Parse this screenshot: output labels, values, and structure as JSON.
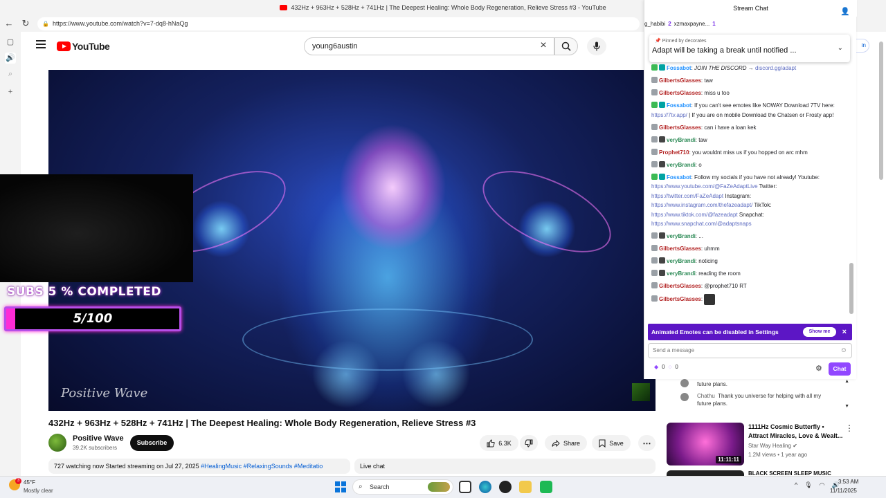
{
  "browser": {
    "window_title": "432Hz + 963Hz + 528Hz + 741Hz | The Deepest Healing: Whole Body Regeneration, Relieve Stress #3 - YouTube",
    "url": "https://www.youtube.com/watch?v=7-dq8-hNaQg",
    "sign_in_peek": "in"
  },
  "youtube": {
    "logo": "YouTube",
    "search_value": "young6austin",
    "video_title": "432Hz + 963Hz + 528Hz + 741Hz | The Deepest Healing: Whole Body Regeneration, Relieve Stress #3",
    "watermark": "Positive Wave",
    "channel_name": "Positive Wave",
    "channel_subs": "39.2K subscribers",
    "subscribe_label": "Subscribe",
    "like_count": "6.3K",
    "share_label": "Share",
    "save_label": "Save",
    "desc_stats": "727 watching now  Started streaming on Jul 27, 2025 ",
    "desc_tags": "#HealingMusic #RelaxingSounds #Meditatio",
    "live_chat_label": "Live chat",
    "peek": [
      {
        "text": "future plans."
      },
      {
        "user": "Chathu",
        "text": "Thank you universe for helping with all my future plans."
      }
    ],
    "recommended": [
      {
        "title": "1111Hz Cosmic Butterfly • Attract Miracles, Love & Wealt...",
        "channel": "Star Way Healing",
        "meta": "1.2M views • 1 year ago",
        "duration": "11:11:11"
      },
      {
        "title": "BLACK SCREEN SLEEP MUSIC"
      }
    ]
  },
  "overlay": {
    "sub_goal_text": "SUBS 5 % COMPLETED",
    "sub_goal_count": "5/100",
    "sub_goal_fraction": 0.05
  },
  "chat": {
    "header": "Stream Chat",
    "topline": [
      {
        "text": "g_habibi"
      },
      {
        "text": "2",
        "bold": true
      },
      {
        "text": "xzmaxpayne..."
      },
      {
        "text": "1",
        "bold": true
      }
    ],
    "pinned_by": "Pinned by decorates",
    "pinned_msg": "Adapt will be taking a break until notified ...",
    "messages": [
      {
        "user": "Fossabot",
        "color": "#1e90ff",
        "text": "JOIN THE DISCORD → ",
        "link": "discord.gg/adapt",
        "italic": true
      },
      {
        "user": "GilbertsGlasses",
        "color": "#b22222",
        "text": "taw"
      },
      {
        "user": "GilbertsGlasses",
        "color": "#b22222",
        "text": "miss u too"
      },
      {
        "user": "Fossabot",
        "color": "#1e90ff",
        "text": "If you can't see emotes like NOWAY Download 7TV here: ",
        "link": "https://7tv.app/",
        "tail": " | If you are on mobile Download the Chatsen or Frosty app!"
      },
      {
        "user": "GilbertsGlasses",
        "color": "#b22222",
        "text": "can i have a loan kek"
      },
      {
        "user": "veryBrandi",
        "color": "#2e8b57",
        "text": "taw"
      },
      {
        "user": "Prophet710",
        "color": "#b22222",
        "text": "you wouldnt miss us if you hopped on arc mhm"
      },
      {
        "user": "veryBrandi",
        "color": "#2e8b57",
        "text": "o"
      },
      {
        "user": "Fossabot",
        "color": "#1e90ff",
        "text": "Follow my socials if you have not already! Youtube: ",
        "link": "https://www.youtube.com/@FaZeAdaptLive",
        "tail": " Twitter: ",
        "link2": "https://twitter.com/FaZeAdapt",
        "tail2": " Instagram: ",
        "link3": "https://www.instagram.com/thefazeadapt/",
        "tail3": " TikTok: ",
        "link4": "https://www.tiktok.com/@fazeadapt",
        "tail4": " Snapchat: ",
        "link5": "https://www.snapchat.com/@adaptsnaps"
      },
      {
        "user": "veryBrandi",
        "color": "#2e8b57",
        "text": "..."
      },
      {
        "user": "GilbertsGlasses",
        "color": "#b22222",
        "text": "uhmm"
      },
      {
        "user": "veryBrandi",
        "color": "#2e8b57",
        "text": "noticing"
      },
      {
        "user": "veryBrandi",
        "color": "#2e8b57",
        "text": "reading the room"
      },
      {
        "user": "GilbertsGlasses",
        "color": "#b22222",
        "text": "@prophet710 RT"
      },
      {
        "user": "GilbertsGlasses",
        "color": "#b22222",
        "text": "",
        "emote": true
      }
    ],
    "banner_text": "Animated Emotes can be disabled in Settings",
    "banner_button": "Show me",
    "input_placeholder": "Send a message",
    "points_a": "0",
    "points_b": "0",
    "send_label": "Chat"
  },
  "taskbar": {
    "temp": "45°F",
    "weather": "Mostly clear",
    "weather_badge": "3",
    "search_label": "Search",
    "time": "3:53 AM",
    "date": "11/11/2025"
  },
  "colors": {
    "youtube_red": "#ff0000",
    "twitch_purple": "#9147ff",
    "banner_purple": "#5c16c5",
    "link_blue": "#065fd4"
  }
}
